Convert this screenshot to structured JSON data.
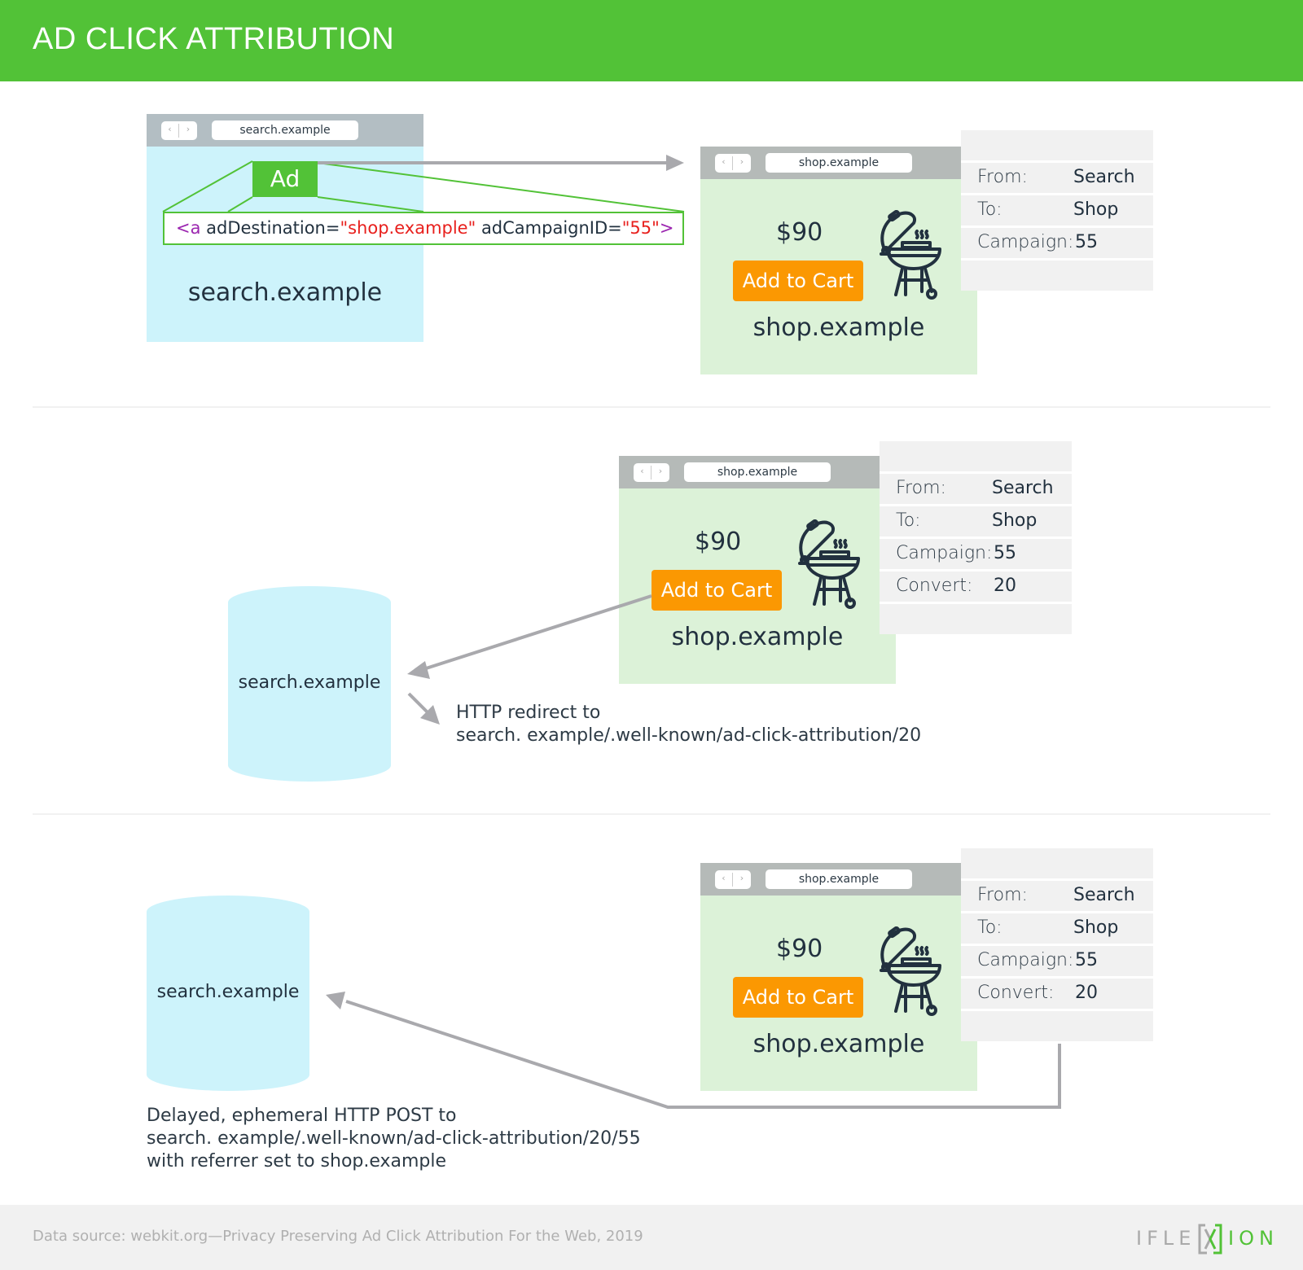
{
  "header": {
    "title": "AD CLICK ATTRIBUTION"
  },
  "colors": {
    "brand_green": "#52c237",
    "search_bg": "#cdf3fb",
    "shop_bg": "#dcf2d8",
    "cart_orange": "#fb9802",
    "arrow_gray": "#a9a9ad",
    "code_tag": "#9c27b0",
    "code_string": "#e8201d"
  },
  "icons": {
    "back": "‹",
    "forward": "›",
    "grill": "grill-icon"
  },
  "step1": {
    "search_browser": {
      "url": "search.example",
      "site_name": "search.example"
    },
    "ad_label": "Ad",
    "code": {
      "open": "<a",
      "attr1": " adDestination=",
      "val1": "\"shop.example\"",
      "attr2": "  adCampaignID=",
      "val2": "\"55\"",
      "close": ">"
    },
    "shop_browser": {
      "url": "shop.example",
      "price": "$90",
      "cart_button": "Add to Cart",
      "site_name": "shop.example"
    },
    "info": [
      {
        "key": "From:",
        "value": "Search"
      },
      {
        "key": "To:",
        "value": "Shop"
      },
      {
        "key": "Campaign:",
        "value": "55"
      }
    ]
  },
  "step2": {
    "shop_browser": {
      "url": "shop.example",
      "price": "$90",
      "cart_button": "Add to Cart",
      "site_name": "shop.example"
    },
    "info": [
      {
        "key": "From:",
        "value": "Search"
      },
      {
        "key": "To:",
        "value": "Shop"
      },
      {
        "key": "Campaign:",
        "value": "55"
      },
      {
        "key": "Convert:",
        "value": "20"
      }
    ],
    "server_label": "search.example",
    "note": [
      "HTTP redirect to",
      "search. example/.well-known/ad-click-attribution/20"
    ]
  },
  "step3": {
    "shop_browser": {
      "url": "shop.example",
      "price": "$90",
      "cart_button": "Add to Cart",
      "site_name": "shop.example"
    },
    "info": [
      {
        "key": "From:",
        "value": "Search"
      },
      {
        "key": "To:",
        "value": "Shop"
      },
      {
        "key": "Campaign:",
        "value": "55"
      },
      {
        "key": "Convert:",
        "value": "20"
      }
    ],
    "server_label": "search.example",
    "note": [
      "Delayed, ephemeral HTTP POST to",
      "search. example/.well-known/ad-click-attribution/20/55",
      "with referrer set to shop.example"
    ]
  },
  "footer": {
    "source": "Data source: webkit.org—Privacy Preserving Ad Click Attribution For the Web, 2019",
    "logo_left": "IFLE",
    "logo_right": "ION"
  }
}
